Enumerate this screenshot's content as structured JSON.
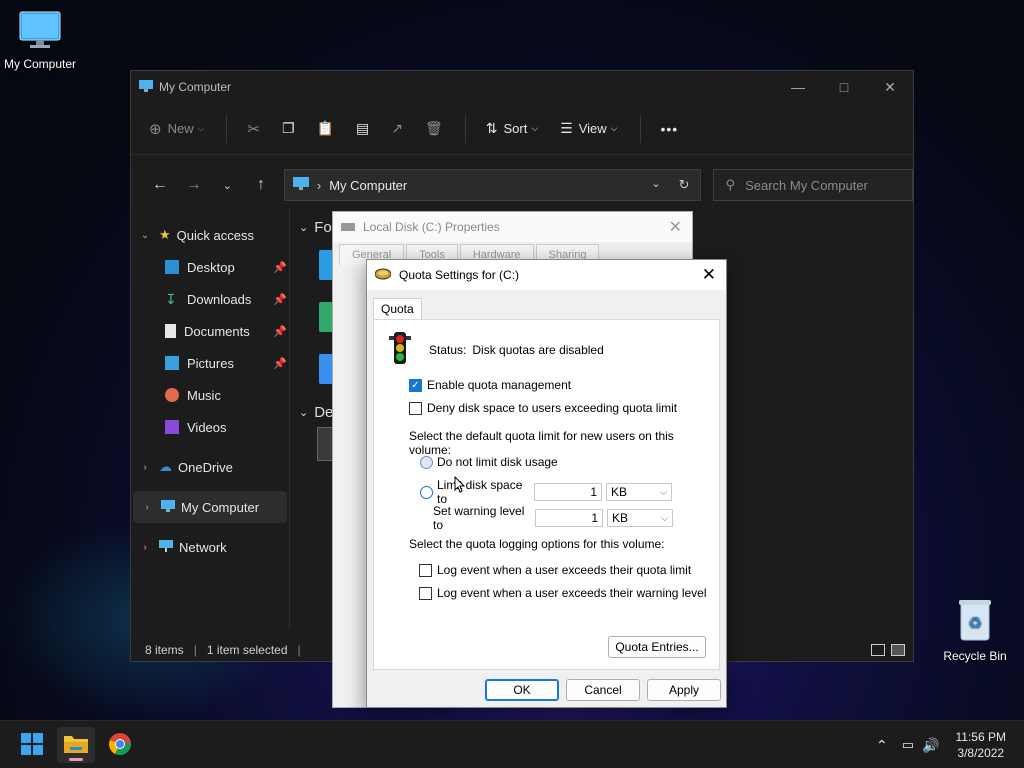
{
  "desktop": {
    "icons": [
      {
        "label": "My Computer"
      },
      {
        "label": "Recycle Bin"
      }
    ]
  },
  "explorer": {
    "title": "My Computer",
    "toolbar": {
      "new_label": "New",
      "sort_label": "Sort",
      "view_label": "View",
      "more_label": "•••"
    },
    "address": {
      "path": "My Computer",
      "search_placeholder": "Search My Computer"
    },
    "nav": {
      "quick_access": "Quick access",
      "items": [
        {
          "label": "Desktop",
          "pinned": true
        },
        {
          "label": "Downloads",
          "pinned": true
        },
        {
          "label": "Documents",
          "pinned": true
        },
        {
          "label": "Pictures",
          "pinned": true
        },
        {
          "label": "Music",
          "pinned": false
        },
        {
          "label": "Videos",
          "pinned": false
        }
      ],
      "onedrive": "OneDrive",
      "my_computer": "My Computer",
      "network": "Network"
    },
    "content": {
      "group1": "Fol",
      "group2": "Dev"
    },
    "status": {
      "items": "8 items",
      "selected": "1 item selected"
    }
  },
  "properties_dialog": {
    "title": "Local Disk (C:) Properties",
    "tabs": [
      "General",
      "Tools",
      "Hardware",
      "Sharing"
    ]
  },
  "quota_dialog": {
    "title": "Quota Settings for  (C:)",
    "tab": "Quota",
    "status_label": "Status:",
    "status_value": "Disk quotas are disabled",
    "enable_quota": "Enable quota management",
    "deny_space": "Deny disk space to users exceeding quota limit",
    "default_limit_heading": "Select the default quota limit for new users on this volume:",
    "no_limit": "Do not limit disk usage",
    "limit_to": "Limit disk space to",
    "limit_value": "1",
    "limit_unit": "KB",
    "warning_label": "Set warning level to",
    "warning_value": "1",
    "warning_unit": "KB",
    "logging_heading": "Select the quota logging options for this volume:",
    "log_limit": "Log event when a user exceeds their quota limit",
    "log_warning": "Log event when a user exceeds their warning level",
    "entries_button": "Quota Entries...",
    "ok": "OK",
    "cancel": "Cancel",
    "apply": "Apply",
    "enable_checked": true,
    "deny_checked": false
  },
  "taskbar": {
    "time": "11:56 PM",
    "date": "3/8/2022"
  }
}
